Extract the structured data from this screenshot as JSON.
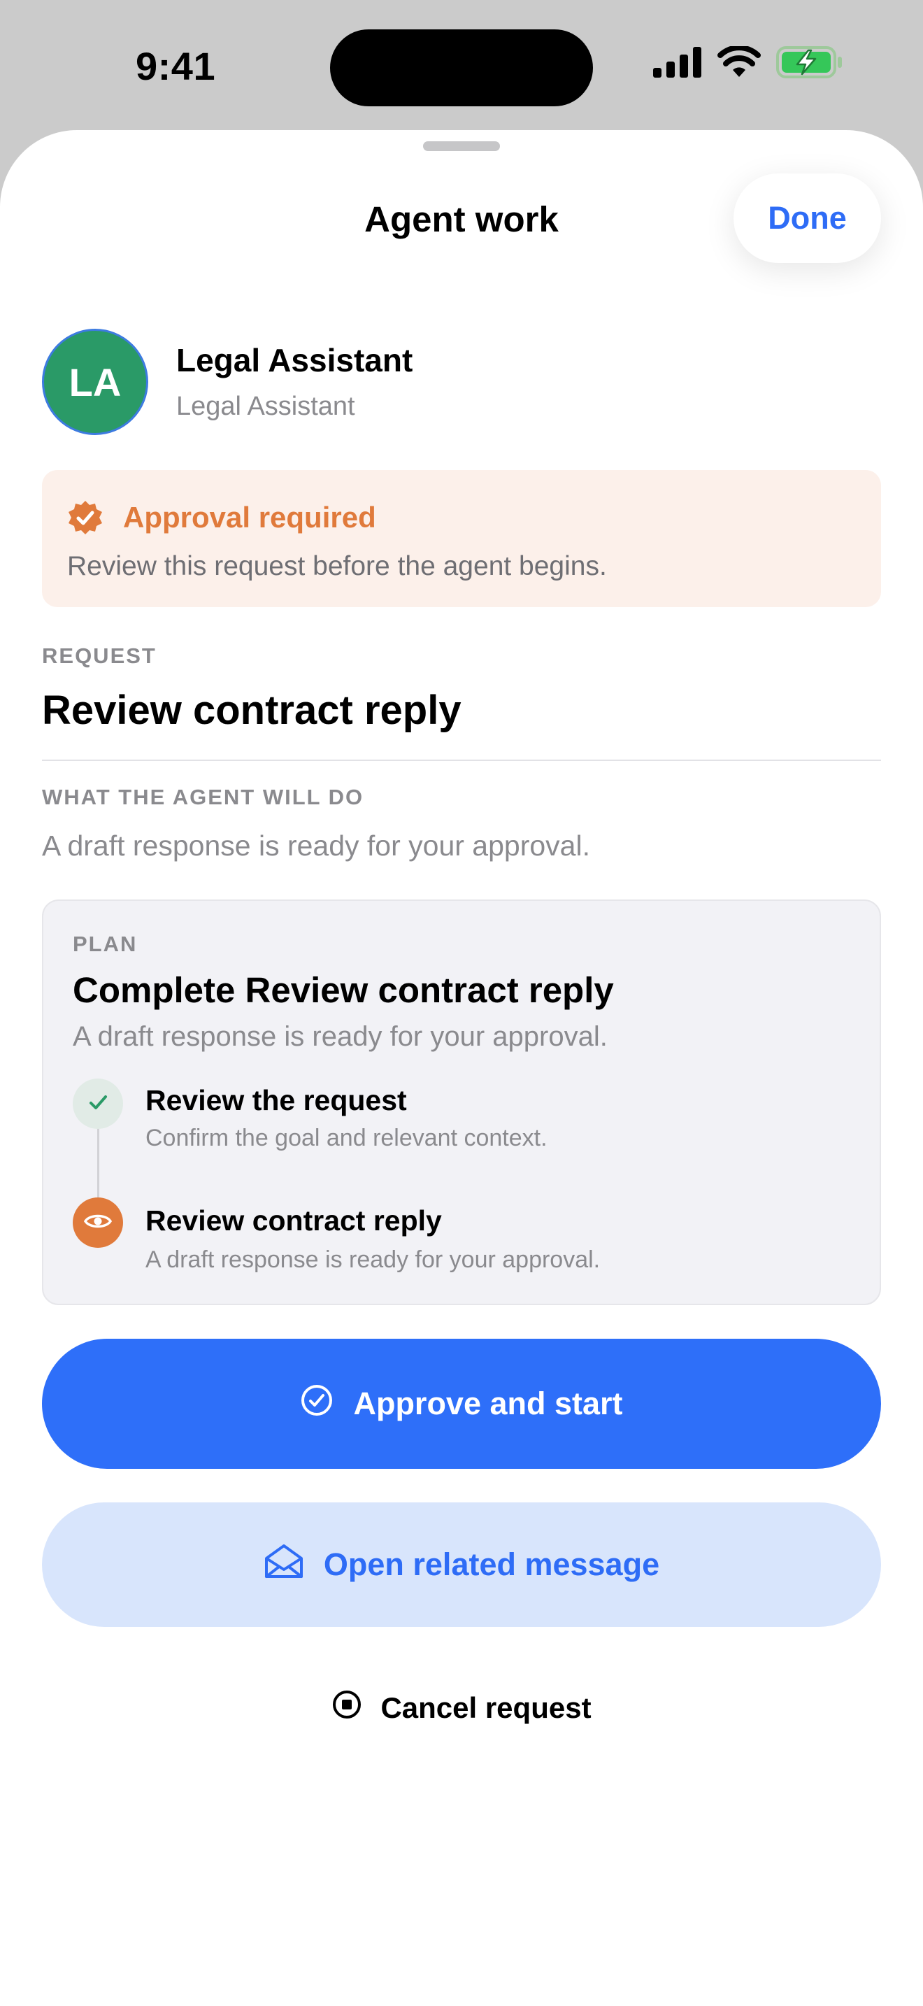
{
  "status_bar": {
    "time": "9:41",
    "icons": [
      "cellular-signal-icon",
      "wifi-icon",
      "battery-charging-icon"
    ]
  },
  "sheet": {
    "title": "Agent work",
    "done_label": "Done"
  },
  "agent": {
    "initials": "LA",
    "name": "Legal Assistant",
    "role": "Legal Assistant",
    "avatar_color": "#2a9a67"
  },
  "approval": {
    "icon": "verified-badge-icon",
    "title": "Approval required",
    "text": "Review this request before the agent begins.",
    "color": "#e07a3b"
  },
  "request": {
    "label": "REQUEST",
    "title": "Review contract reply"
  },
  "will_do": {
    "label": "WHAT THE AGENT WILL DO",
    "text": "A draft response is ready for your approval."
  },
  "plan": {
    "label": "PLAN",
    "title": "Complete Review contract reply",
    "subtitle": "A draft response is ready for your approval.",
    "steps": [
      {
        "title": "Review the request",
        "desc": "Confirm the goal and relevant context.",
        "state": "done",
        "icon": "checkmark-icon"
      },
      {
        "title": "Review contract reply",
        "desc": "A draft response is ready for your approval.",
        "state": "current",
        "icon": "eye-icon"
      }
    ]
  },
  "actions": {
    "approve_label": "Approve and start",
    "approve_icon": "check-circle-icon",
    "open_label": "Open related message",
    "open_icon": "open-envelope-icon",
    "cancel_label": "Cancel request",
    "cancel_icon": "stop-circle-icon"
  },
  "colors": {
    "accent": "#2e6ff9",
    "accent_soft": "#d8e5fc",
    "warning": "#e07a3b"
  }
}
